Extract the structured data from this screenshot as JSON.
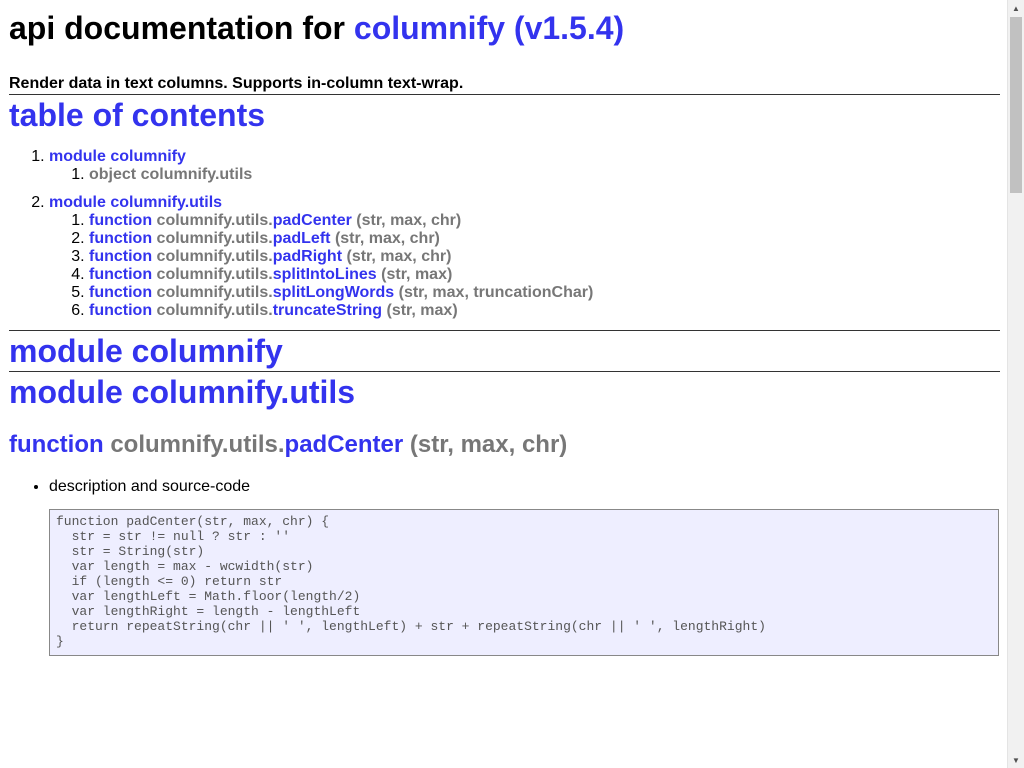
{
  "header": {
    "title_prefix": "api documentation for",
    "title_link": "columnify (v1.5.4)",
    "subtitle": "Render data in text columns. Supports in-column text-wrap."
  },
  "toc": {
    "heading": "table of contents",
    "modules": [
      {
        "label": "module columnify",
        "items": [
          {
            "kind": "object",
            "name": "columnify.utils"
          }
        ]
      },
      {
        "label": "module columnify.utils",
        "items": [
          {
            "kind": "function",
            "prefix": "columnify.utils.",
            "name": "padCenter",
            "args": "(str, max, chr)"
          },
          {
            "kind": "function",
            "prefix": "columnify.utils.",
            "name": "padLeft",
            "args": "(str, max, chr)"
          },
          {
            "kind": "function",
            "prefix": "columnify.utils.",
            "name": "padRight",
            "args": "(str, max, chr)"
          },
          {
            "kind": "function",
            "prefix": "columnify.utils.",
            "name": "splitIntoLines",
            "args": "(str, max)"
          },
          {
            "kind": "function",
            "prefix": "columnify.utils.",
            "name": "splitLongWords",
            "args": "(str, max, truncationChar)"
          },
          {
            "kind": "function",
            "prefix": "columnify.utils.",
            "name": "truncateString",
            "args": "(str, max)"
          }
        ]
      }
    ]
  },
  "sections": {
    "module1_heading": "module columnify",
    "module2_heading": "module columnify.utils"
  },
  "function_detail": {
    "kind": "function",
    "prefix": "columnify.utils.",
    "name": "padCenter",
    "args": "(str, max, chr)",
    "bullet": "description and source-code",
    "code": "function padCenter(str, max, chr) {\n  str = str != null ? str : ''\n  str = String(str)\n  var length = max - wcwidth(str)\n  if (length <= 0) return str\n  var lengthLeft = Math.floor(length/2)\n  var lengthRight = length - lengthLeft\n  return repeatString(chr || ' ', lengthLeft) + str + repeatString(chr || ' ', lengthRight)\n}"
  },
  "colors": {
    "link": "#3333ee",
    "muted": "#777777",
    "code_background": "#eeeeff"
  }
}
